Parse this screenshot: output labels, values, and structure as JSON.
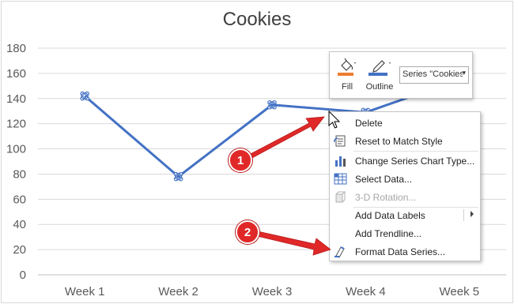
{
  "chart_data": {
    "type": "line",
    "title": "Cookies",
    "categories": [
      "Week 1",
      "Week 2",
      "Week 3",
      "Week 4",
      "Week 5"
    ],
    "series": [
      {
        "name": "Cookies",
        "values": [
          142,
          78,
          135,
          129,
          155
        ],
        "color": "#4472c4",
        "selected": true
      }
    ],
    "y_ticks": [
      "0",
      "20",
      "40",
      "60",
      "80",
      "100",
      "120",
      "140",
      "160",
      "180"
    ],
    "ylim": [
      0,
      180
    ],
    "grid": true
  },
  "mini_toolbar": {
    "fill_label": "Fill",
    "outline_label": "Outline",
    "series_select_value": "Series \"Cookies\"",
    "fill_color": "#ed7d31",
    "outline_color": "#4472c4"
  },
  "context_menu": {
    "items": [
      {
        "label": "Delete",
        "icon": "none",
        "disabled": false
      },
      {
        "label": "Reset to Match Style",
        "icon": "reset-style-icon",
        "disabled": false
      },
      {
        "label": "Change Series Chart Type...",
        "icon": "chart-type-icon",
        "disabled": false
      },
      {
        "label": "Select Data...",
        "icon": "select-data-icon",
        "disabled": false
      },
      {
        "label": "3-D Rotation...",
        "icon": "rotation-3d-icon",
        "disabled": true
      },
      {
        "label": "Add Data Labels",
        "icon": "none",
        "disabled": false,
        "submenu": true
      },
      {
        "label": "Add Trendline...",
        "icon": "none",
        "disabled": false
      },
      {
        "label": "Format Data Series...",
        "icon": "format-series-icon",
        "disabled": false
      }
    ]
  },
  "annotations": {
    "badge_1": "1",
    "badge_2": "2",
    "color": "#e02828"
  }
}
